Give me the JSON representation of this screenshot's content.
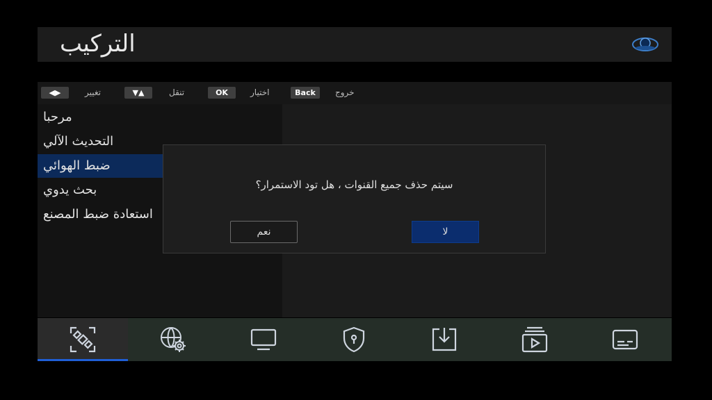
{
  "header": {
    "title": "التركيب"
  },
  "hints": [
    {
      "key": "◀▶",
      "label": "تغيير"
    },
    {
      "key": "▼▲",
      "label": "تنقل"
    },
    {
      "key": "OK",
      "label": "اختيار"
    },
    {
      "key": "Back",
      "label": "خروج"
    }
  ],
  "menu": {
    "items": [
      {
        "label": "مرحبا"
      },
      {
        "label": "التحديث الآلي"
      },
      {
        "label": "ضبط الهوائي"
      },
      {
        "label": "بحث يدوي"
      },
      {
        "label": "استعادة ضبط المصنع"
      }
    ],
    "selected_index": 2
  },
  "dialog": {
    "message": "سيتم حذف جميع القنوات ، هل تود الاستمرار؟",
    "yes_label": "نعم",
    "no_label": "لا"
  },
  "tabs": [
    {
      "icon": "satellite-icon"
    },
    {
      "icon": "network-settings-icon"
    },
    {
      "icon": "tv-icon"
    },
    {
      "icon": "security-shield-icon"
    },
    {
      "icon": "download-icon"
    },
    {
      "icon": "media-player-icon"
    },
    {
      "icon": "subtitle-icon"
    }
  ],
  "colors": {
    "accent": "#1f5fd6",
    "selected": "#0c2a5a",
    "dialog_button": "#0b2d6e"
  }
}
